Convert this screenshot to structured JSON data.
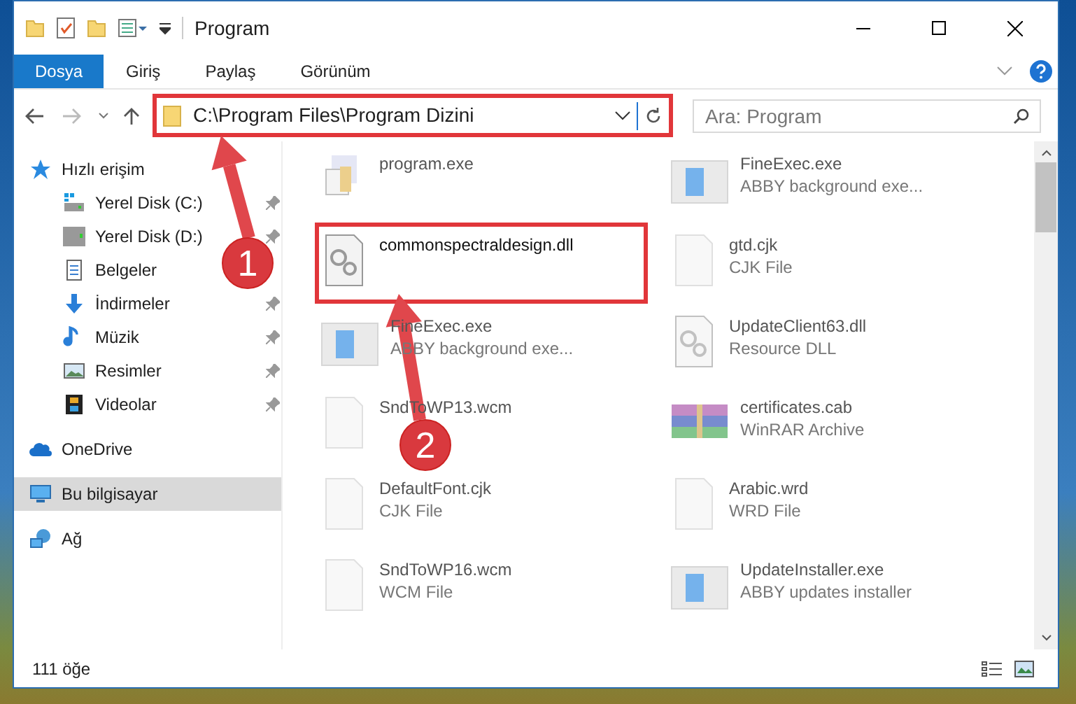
{
  "window": {
    "title": "Program"
  },
  "ribbon_tabs": [
    {
      "label": "Dosya",
      "selected": true
    },
    {
      "label": "Giriş",
      "selected": false
    },
    {
      "label": "Paylaş",
      "selected": false
    },
    {
      "label": "Görünüm",
      "selected": false
    }
  ],
  "address": {
    "path": "C:\\Program Files\\Program Dizini",
    "highlighted": true
  },
  "search": {
    "placeholder": "Ara: Program"
  },
  "sidebar": {
    "items": [
      {
        "label": "Hızlı erişim",
        "kind": "star",
        "selected": false,
        "children": [
          {
            "label": "Yerel Disk (C:)",
            "kind": "systemdrive",
            "pinned": true
          },
          {
            "label": "Yerel Disk (D:)",
            "kind": "drive",
            "pinned": true
          },
          {
            "label": "Belgeler",
            "kind": "documents"
          },
          {
            "label": "İndirmeler",
            "kind": "downloads",
            "pinned": true
          },
          {
            "label": "Müzik",
            "kind": "music",
            "pinned": true
          },
          {
            "label": "Resimler",
            "kind": "pictures",
            "pinned": true
          },
          {
            "label": "Videolar",
            "kind": "videos",
            "pinned": true
          }
        ]
      },
      {
        "label": "OneDrive",
        "kind": "cloud",
        "selected": false
      },
      {
        "label": "Bu bilgisayar",
        "kind": "computer",
        "selected": true
      },
      {
        "label": "Ağ",
        "kind": "network",
        "selected": false
      }
    ]
  },
  "files": [
    {
      "name": "program.exe",
      "kind": "program",
      "highlighted": false
    },
    {
      "name": "FineExec.exe",
      "type": "ABBY background exe...",
      "kind": "application",
      "highlighted": false
    },
    {
      "name": "commonspectraldesign.dll",
      "kind": "library",
      "highlighted": true
    },
    {
      "name": "gtd.cjk",
      "type": "CJK File",
      "kind": "document",
      "highlighted": false
    },
    {
      "name": "FineExec.exe",
      "type": "ABBY background exe...",
      "kind": "application",
      "highlighted": false
    },
    {
      "name": "UpdateClient63.dll",
      "type": "Resource DLL",
      "kind": "library",
      "highlighted": false
    },
    {
      "name": "SndToWP13.wcm",
      "kind": "document",
      "highlighted": false
    },
    {
      "name": "certificates.cab",
      "type": "WinRAR Archive",
      "kind": "archive",
      "highlighted": false
    },
    {
      "name": "DefaultFont.cjk",
      "type": "CJK File",
      "kind": "document",
      "highlighted": false
    },
    {
      "name": "Arabic.wrd",
      "type": "WRD File",
      "kind": "document",
      "highlighted": false
    },
    {
      "name": "SndToWP16.wcm",
      "type": "WCM File",
      "kind": "document",
      "highlighted": false
    },
    {
      "name": "UpdateInstaller.exe",
      "type": "ABBY updates installer",
      "kind": "application",
      "highlighted": false
    }
  ],
  "status_bar": {
    "count": "111 öğe"
  },
  "annotations": [
    {
      "label": "1"
    },
    {
      "label": "2"
    }
  ]
}
